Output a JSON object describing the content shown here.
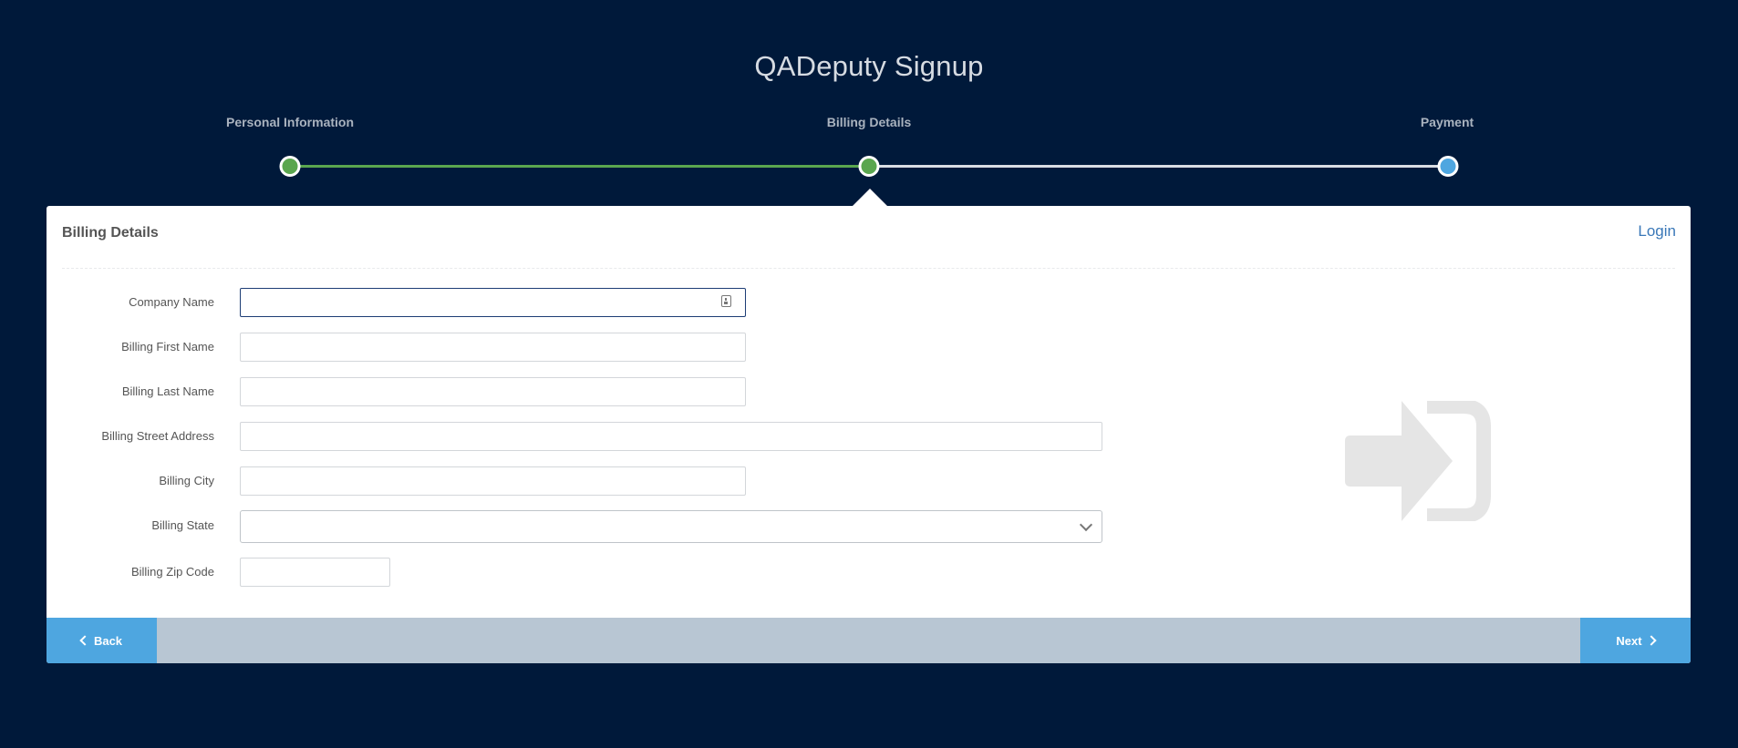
{
  "page": {
    "title": "QADeputy Signup"
  },
  "steps": [
    {
      "label": "Personal Information",
      "status": "complete"
    },
    {
      "label": "Billing Details",
      "status": "current"
    },
    {
      "label": "Payment",
      "status": "upcoming"
    }
  ],
  "panel": {
    "title": "Billing Details",
    "login_label": "Login",
    "fields": {
      "company_name": {
        "label": "Company Name",
        "value": ""
      },
      "first_name": {
        "label": "Billing First Name",
        "value": ""
      },
      "last_name": {
        "label": "Billing Last Name",
        "value": ""
      },
      "street": {
        "label": "Billing Street Address",
        "value": ""
      },
      "city": {
        "label": "Billing City",
        "value": ""
      },
      "state": {
        "label": "Billing State",
        "value": ""
      },
      "zip": {
        "label": "Billing Zip Code",
        "value": ""
      }
    },
    "decorative_icon": "sign-in-icon"
  },
  "footer": {
    "back_label": "Back",
    "next_label": "Next"
  },
  "colors": {
    "background": "#00193a",
    "complete": "#5aa64f",
    "accent": "#4ea6e0",
    "footer_bar": "#b8c6d3",
    "link": "#3a78b8"
  }
}
